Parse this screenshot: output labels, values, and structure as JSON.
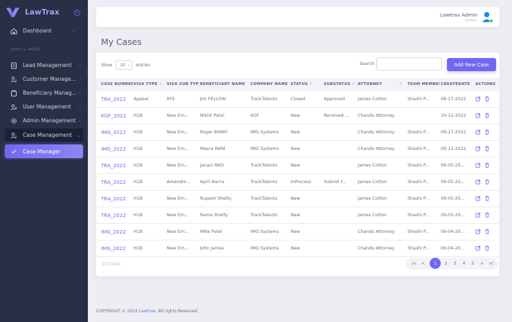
{
  "brand": {
    "name": "LawTrax"
  },
  "sidebar": {
    "section_label": "APPS & PAGES",
    "items": [
      {
        "label": "Dashboard",
        "icon": "home-icon"
      },
      {
        "label": "Lead Management",
        "icon": "document-icon"
      },
      {
        "label": "Customer Manage...",
        "icon": "users-icon"
      },
      {
        "label": "Beneficiary Manag...",
        "icon": "clipboard-icon"
      },
      {
        "label": "User Management",
        "icon": "user-plus-icon"
      },
      {
        "label": "Admin Management",
        "icon": "gear-icon"
      },
      {
        "label": "Case Management",
        "icon": "users-icon"
      },
      {
        "label": "Case Manager",
        "icon": "check-icon"
      }
    ]
  },
  "header": {
    "user_name": "Lawtrax Admin",
    "user_role": "Admin"
  },
  "page": {
    "title": "My Cases"
  },
  "table": {
    "show_label": "Show",
    "show_value": "10",
    "entries_label": "entries",
    "search_label": "Search:",
    "search_value": "",
    "add_button": "Add New Case",
    "columns": [
      "CASE NUMBER",
      "VISA TYPE",
      "VISA SUB TYPE",
      "BENEFICIARY NAME",
      "COMPANY NAME",
      "STATUS",
      "SUBSTATUS",
      "ATTORNEY",
      "",
      "TEAM MEMBER",
      "CREATEDATE",
      "ACTIONS"
    ],
    "rows": [
      [
        "TRA_2022",
        "Appeal",
        "RFE",
        "Jim FELLOW",
        "TrackTalents",
        "Closed",
        "Approved",
        "James Cotton",
        "Shashi P...",
        "08-17-2022"
      ],
      [
        "KGF_2022",
        "H1B",
        "New Em...",
        "Nikhil Patel",
        "KGF",
        "New",
        "Received ...",
        "Chandu Attorney",
        "",
        "10-12-2022"
      ],
      [
        "IMG_2022",
        "H1B",
        "New Em...",
        "Roger BINNY",
        "IMG Systems",
        "New",
        "",
        "Chandu Attorney",
        "Shashi P...",
        "09-17-2022"
      ],
      [
        "IMG_2022",
        "H1B",
        "New Em...",
        "Meera RANI",
        "IMG Systems",
        "New",
        "",
        "Chandu Attorney",
        "Shashi P...",
        "09-12-2022"
      ],
      [
        "TRA_2022",
        "H1B",
        "New Em...",
        "Janavi RAO",
        "TrackTalents",
        "New",
        "",
        "James Cotton",
        "Shashi P...",
        "09-05-20..."
      ],
      [
        "TRA_2022",
        "H1B",
        "Amendm...",
        "April Iberra",
        "TrackTalents",
        "InProcess",
        "Submit t...",
        "James Cotton",
        "Shashi P...",
        "09-05-20..."
      ],
      [
        "TRA_2022",
        "H1B",
        "New Em...",
        "Rupesh Shetty",
        "TrackTalents",
        "New",
        "",
        "James Cotton",
        "Shashi P...",
        "09-05-20..."
      ],
      [
        "TRA_2022",
        "H1B",
        "New Em...",
        "Rama Shetty",
        "TrackTalents",
        "New",
        "",
        "James Cotton",
        "Shashi P...",
        "09-05-20..."
      ],
      [
        "IMG_2022",
        "H1B",
        "New Em...",
        "Mike Patel",
        "IMG Systems",
        "New",
        "",
        "Chandu Attorney",
        "Shashi P...",
        "09-04-20..."
      ],
      [
        "IMG_2022",
        "H1B",
        "New Em...",
        "John James",
        "IMG Systems",
        "New",
        "",
        "Chandu Attorney",
        "Shashi P...",
        "09-04-20..."
      ]
    ],
    "total_label": "113 total"
  },
  "pagination": {
    "first": "|<",
    "prev": "<",
    "pages": [
      "1",
      "2",
      "3",
      "4",
      "5"
    ],
    "active": "1",
    "next": ">",
    "last": ">|"
  },
  "footer": {
    "prefix": "COPYRIGHT © 2022",
    "link": "Lawtrax",
    "suffix": ", All rights Reserved"
  },
  "colors": {
    "accent": "#7367f0",
    "sidebar_bg": "#283046",
    "page_bg": "#eceef4"
  }
}
